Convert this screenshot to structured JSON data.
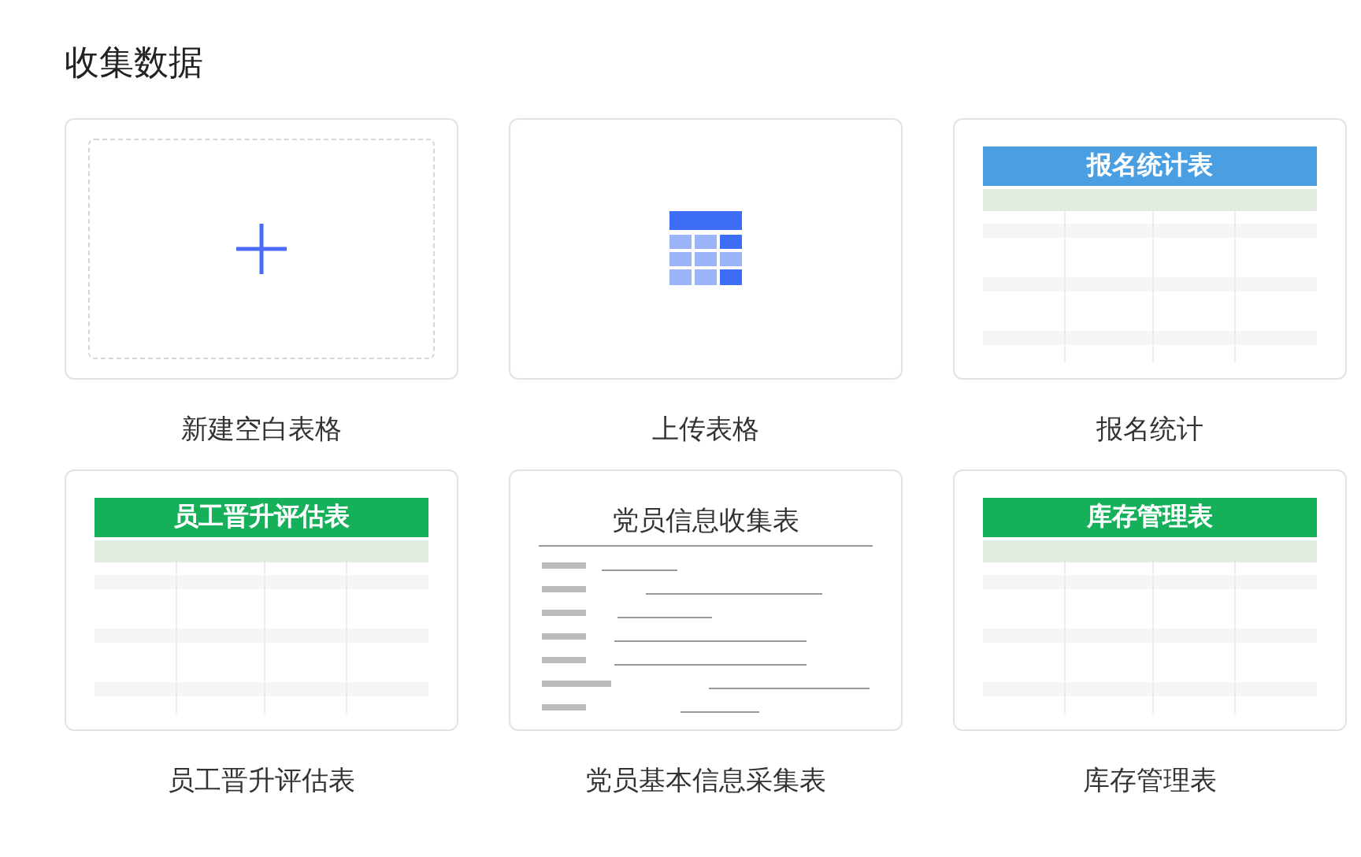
{
  "section": {
    "title": "收集数据"
  },
  "cards": [
    {
      "kind": "blank",
      "label": "新建空白表格"
    },
    {
      "kind": "upload",
      "label": "上传表格"
    },
    {
      "kind": "template",
      "label": "报名统计",
      "preview": {
        "kind": "table",
        "title": "报名统计表",
        "color": "#4a9fe3"
      }
    },
    {
      "kind": "template",
      "label": "员工晋升评估表",
      "preview": {
        "kind": "table",
        "title": "员工晋升评估表",
        "color": "#16b05a"
      }
    },
    {
      "kind": "template",
      "label": "党员基本信息采集表",
      "preview": {
        "kind": "form",
        "title": "党员信息收集表"
      }
    },
    {
      "kind": "template",
      "label": "库存管理表",
      "preview": {
        "kind": "table",
        "title": "库存管理表",
        "color": "#16b05a"
      }
    }
  ]
}
